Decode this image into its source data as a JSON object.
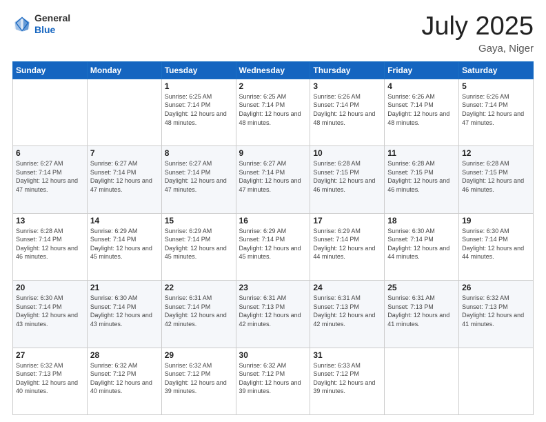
{
  "header": {
    "logo_general": "General",
    "logo_blue": "Blue",
    "month_title": "July 2025",
    "location": "Gaya, Niger"
  },
  "days_of_week": [
    "Sunday",
    "Monday",
    "Tuesday",
    "Wednesday",
    "Thursday",
    "Friday",
    "Saturday"
  ],
  "weeks": [
    [
      {
        "day": "",
        "info": ""
      },
      {
        "day": "",
        "info": ""
      },
      {
        "day": "1",
        "sunrise": "6:25 AM",
        "sunset": "7:14 PM",
        "daylight": "12 hours and 48 minutes."
      },
      {
        "day": "2",
        "sunrise": "6:25 AM",
        "sunset": "7:14 PM",
        "daylight": "12 hours and 48 minutes."
      },
      {
        "day": "3",
        "sunrise": "6:26 AM",
        "sunset": "7:14 PM",
        "daylight": "12 hours and 48 minutes."
      },
      {
        "day": "4",
        "sunrise": "6:26 AM",
        "sunset": "7:14 PM",
        "daylight": "12 hours and 48 minutes."
      },
      {
        "day": "5",
        "sunrise": "6:26 AM",
        "sunset": "7:14 PM",
        "daylight": "12 hours and 47 minutes."
      }
    ],
    [
      {
        "day": "6",
        "sunrise": "6:27 AM",
        "sunset": "7:14 PM",
        "daylight": "12 hours and 47 minutes."
      },
      {
        "day": "7",
        "sunrise": "6:27 AM",
        "sunset": "7:14 PM",
        "daylight": "12 hours and 47 minutes."
      },
      {
        "day": "8",
        "sunrise": "6:27 AM",
        "sunset": "7:14 PM",
        "daylight": "12 hours and 47 minutes."
      },
      {
        "day": "9",
        "sunrise": "6:27 AM",
        "sunset": "7:14 PM",
        "daylight": "12 hours and 47 minutes."
      },
      {
        "day": "10",
        "sunrise": "6:28 AM",
        "sunset": "7:15 PM",
        "daylight": "12 hours and 46 minutes."
      },
      {
        "day": "11",
        "sunrise": "6:28 AM",
        "sunset": "7:15 PM",
        "daylight": "12 hours and 46 minutes."
      },
      {
        "day": "12",
        "sunrise": "6:28 AM",
        "sunset": "7:15 PM",
        "daylight": "12 hours and 46 minutes."
      }
    ],
    [
      {
        "day": "13",
        "sunrise": "6:28 AM",
        "sunset": "7:14 PM",
        "daylight": "12 hours and 46 minutes."
      },
      {
        "day": "14",
        "sunrise": "6:29 AM",
        "sunset": "7:14 PM",
        "daylight": "12 hours and 45 minutes."
      },
      {
        "day": "15",
        "sunrise": "6:29 AM",
        "sunset": "7:14 PM",
        "daylight": "12 hours and 45 minutes."
      },
      {
        "day": "16",
        "sunrise": "6:29 AM",
        "sunset": "7:14 PM",
        "daylight": "12 hours and 45 minutes."
      },
      {
        "day": "17",
        "sunrise": "6:29 AM",
        "sunset": "7:14 PM",
        "daylight": "12 hours and 44 minutes."
      },
      {
        "day": "18",
        "sunrise": "6:30 AM",
        "sunset": "7:14 PM",
        "daylight": "12 hours and 44 minutes."
      },
      {
        "day": "19",
        "sunrise": "6:30 AM",
        "sunset": "7:14 PM",
        "daylight": "12 hours and 44 minutes."
      }
    ],
    [
      {
        "day": "20",
        "sunrise": "6:30 AM",
        "sunset": "7:14 PM",
        "daylight": "12 hours and 43 minutes."
      },
      {
        "day": "21",
        "sunrise": "6:30 AM",
        "sunset": "7:14 PM",
        "daylight": "12 hours and 43 minutes."
      },
      {
        "day": "22",
        "sunrise": "6:31 AM",
        "sunset": "7:14 PM",
        "daylight": "12 hours and 42 minutes."
      },
      {
        "day": "23",
        "sunrise": "6:31 AM",
        "sunset": "7:13 PM",
        "daylight": "12 hours and 42 minutes."
      },
      {
        "day": "24",
        "sunrise": "6:31 AM",
        "sunset": "7:13 PM",
        "daylight": "12 hours and 42 minutes."
      },
      {
        "day": "25",
        "sunrise": "6:31 AM",
        "sunset": "7:13 PM",
        "daylight": "12 hours and 41 minutes."
      },
      {
        "day": "26",
        "sunrise": "6:32 AM",
        "sunset": "7:13 PM",
        "daylight": "12 hours and 41 minutes."
      }
    ],
    [
      {
        "day": "27",
        "sunrise": "6:32 AM",
        "sunset": "7:13 PM",
        "daylight": "12 hours and 40 minutes."
      },
      {
        "day": "28",
        "sunrise": "6:32 AM",
        "sunset": "7:12 PM",
        "daylight": "12 hours and 40 minutes."
      },
      {
        "day": "29",
        "sunrise": "6:32 AM",
        "sunset": "7:12 PM",
        "daylight": "12 hours and 39 minutes."
      },
      {
        "day": "30",
        "sunrise": "6:32 AM",
        "sunset": "7:12 PM",
        "daylight": "12 hours and 39 minutes."
      },
      {
        "day": "31",
        "sunrise": "6:33 AM",
        "sunset": "7:12 PM",
        "daylight": "12 hours and 39 minutes."
      },
      {
        "day": "",
        "info": ""
      },
      {
        "day": "",
        "info": ""
      }
    ]
  ]
}
